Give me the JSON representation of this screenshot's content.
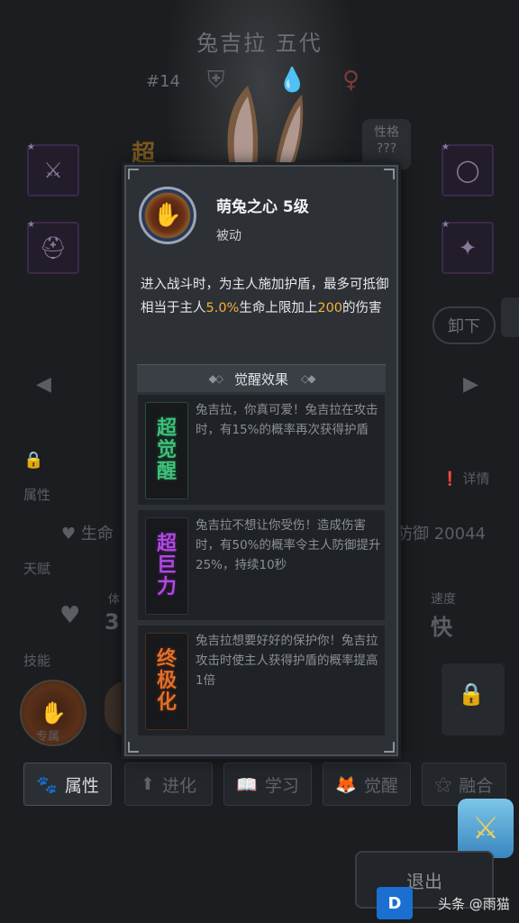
{
  "hero": {
    "name": "兔吉拉 五代",
    "number": "#14",
    "personality_label": "性格",
    "personality_value": "???",
    "unload_label": "卸下"
  },
  "skill": {
    "name": "萌兔之心 5级",
    "type": "被动",
    "desc_part1": "进入战斗时，为主人施加护盾，最多可抵御相当于主人",
    "desc_value1": "5.0%",
    "desc_part2": "生命上限加上",
    "desc_value2": "200",
    "desc_part3": "的伤害"
  },
  "awakening": {
    "title": "觉醒效果",
    "items": [
      {
        "badge": [
          "超",
          "觉",
          "醒"
        ],
        "color": "#3fc07a",
        "text": "兔吉拉，你真可爱！兔吉拉在攻击时，有15%的概率再次获得护盾"
      },
      {
        "badge": [
          "超",
          "巨",
          "力"
        ],
        "color": "#b04ae0",
        "text": "兔吉拉不想让你受伤！造成伤害时，有50%的概率令主人防御提升25%，持续10秒"
      },
      {
        "badge": [
          "终",
          "极",
          "化"
        ],
        "color": "#e0702a",
        "text": "兔吉拉想要好好的保护你！兔吉拉攻击时使主人获得护盾的概率提高1倍"
      }
    ]
  },
  "background": {
    "attr_label": "属性",
    "talent_label": "天赋",
    "skill_label": "技能",
    "hp_label": "生命",
    "def_text": "防御 20044",
    "speed_label": "速度",
    "speed_value": "快",
    "detail_label": "详情",
    "body_label": "体",
    "body_value": "3.",
    "exclusive_label": "专属"
  },
  "tabs": [
    {
      "label": "属性",
      "icon": "paw-icon"
    },
    {
      "label": "进化",
      "icon": "arrow-up-icon"
    },
    {
      "label": "学习",
      "icon": "book-icon"
    },
    {
      "label": "觉醒",
      "icon": "fox-icon"
    },
    {
      "label": "融合",
      "icon": "merge-icon"
    }
  ],
  "exit_label": "退出",
  "watermark": "头条 @雨猫",
  "colors": {
    "highlight": "#f3b23a",
    "modal_bg": "#2d3136"
  }
}
